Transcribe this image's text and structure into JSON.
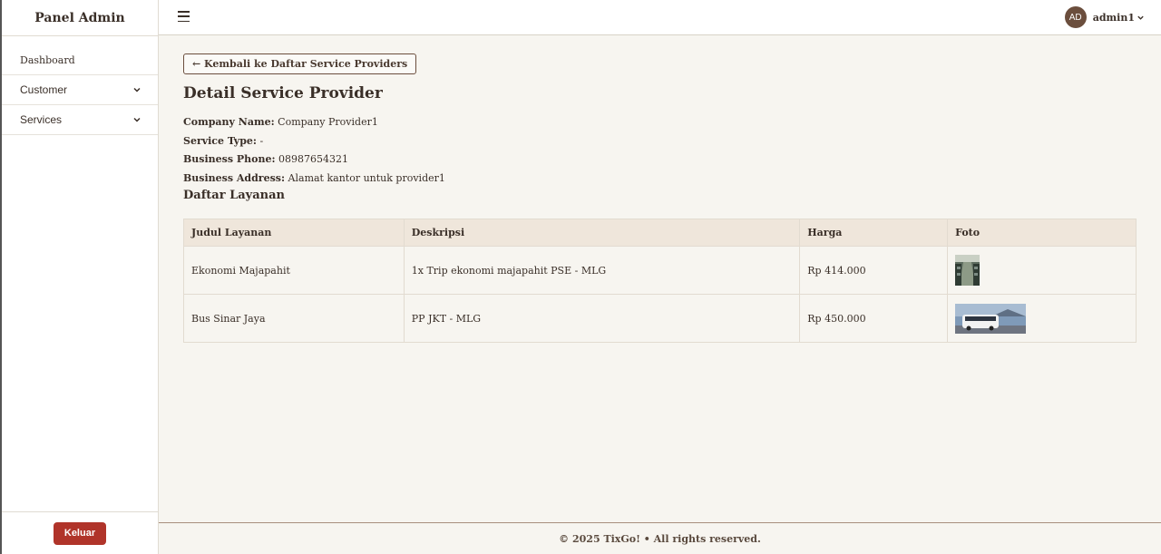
{
  "sidebar": {
    "brand": "Panel Admin",
    "items": [
      {
        "label": "Dashboard"
      },
      {
        "label": "Customer"
      },
      {
        "label": "Services"
      }
    ],
    "logout_label": "Keluar"
  },
  "topbar": {
    "avatar_initials": "AD",
    "username": "admin1"
  },
  "main": {
    "back_label": "← Kembali ke Daftar Service Providers",
    "title": "Detail Service Provider",
    "fields": [
      {
        "label": "Company Name:",
        "value": "Company Provider1"
      },
      {
        "label": "Service Type:",
        "value": "-"
      },
      {
        "label": "Business Phone:",
        "value": "08987654321"
      },
      {
        "label": "Business Address:",
        "value": "Alamat kantor untuk provider1"
      }
    ],
    "section_title": "Daftar Layanan",
    "table": {
      "columns": [
        "Judul Layanan",
        "Deskripsi",
        "Harga",
        "Foto"
      ],
      "rows": [
        {
          "judul": "Ekonomi Majapahit",
          "deskripsi": "1x Trip ekonomi majapahit PSE - MLG",
          "harga": "Rp 414.000",
          "foto": "train-interior-photo"
        },
        {
          "judul": "Bus Sinar Jaya",
          "deskripsi": "PP JKT - MLG",
          "harga": "Rp 450.000",
          "foto": "bus-photo"
        }
      ]
    }
  },
  "footer": {
    "text": "© 2025 TixGo! • All rights reserved."
  },
  "colors": {
    "accent": "#6b4e3d",
    "danger": "#b0342a",
    "background": "#f7f5f0",
    "table_header": "#efe6db"
  }
}
